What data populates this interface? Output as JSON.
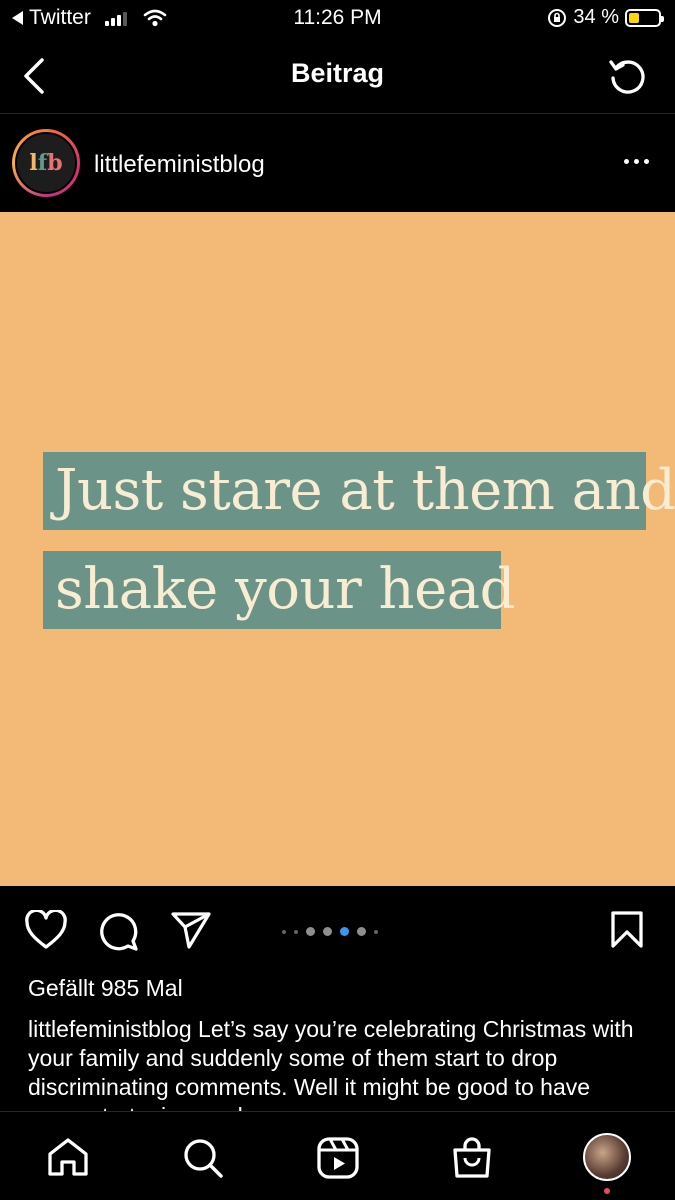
{
  "status_bar": {
    "back_app": "Twitter",
    "time": "11:26 PM",
    "battery_text": "34 %",
    "battery_level": 0.34
  },
  "header": {
    "title": "Beitrag"
  },
  "post": {
    "username": "littlefeministblog",
    "avatar_text": [
      "l",
      "f",
      "b"
    ],
    "image_lines": [
      "Just stare at them and",
      "shake your head"
    ],
    "carousel": {
      "count": 7,
      "active_index": 4
    },
    "likes": "Gefällt 985 Mal",
    "caption_user": "littlefeministblog",
    "caption_text": " Let’s say you’re celebrating Christmas with your family and suddenly some of them start to drop discriminating comments. Well it might be good to have some strategies ready."
  },
  "colors": {
    "image_bg": "#f2b977",
    "highlight": "#6b9388",
    "quote_text": "#f8ecd2",
    "accent_blue": "#3897f0"
  },
  "icons": {
    "like": "heart-icon",
    "comment": "comment-icon",
    "share": "send-icon",
    "save": "bookmark-icon",
    "tabs": [
      "home-icon",
      "search-icon",
      "reels-icon",
      "shop-icon",
      "profile-avatar"
    ]
  }
}
